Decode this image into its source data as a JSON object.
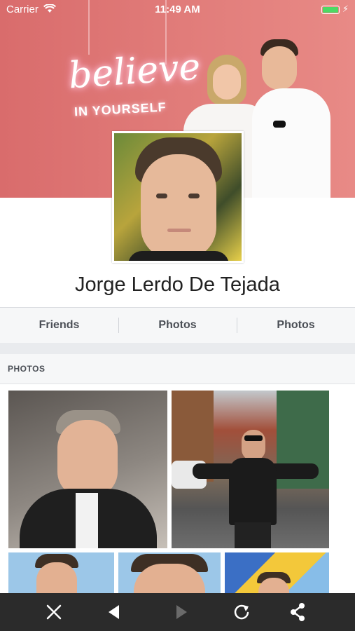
{
  "status_bar": {
    "carrier": "Carrier",
    "time": "11:49 AM"
  },
  "cover": {
    "neon_line1": "believe",
    "neon_line2": "IN YOURSELF"
  },
  "profile": {
    "name": "Jorge Lerdo De Tejada"
  },
  "tabs": [
    {
      "label": "Friends"
    },
    {
      "label": "Photos"
    },
    {
      "label": "Photos"
    }
  ],
  "section": {
    "title": "PHOTOS"
  },
  "toolbar": {
    "buttons": [
      {
        "icon": "close-icon"
      },
      {
        "icon": "back-icon"
      },
      {
        "icon": "forward-icon",
        "disabled": true
      },
      {
        "icon": "reload-icon"
      },
      {
        "icon": "share-icon"
      }
    ]
  },
  "colors": {
    "battery": "#4cd964",
    "toolbar_bg": "#2b2b2b",
    "cover_bg": "#d96c6c"
  }
}
